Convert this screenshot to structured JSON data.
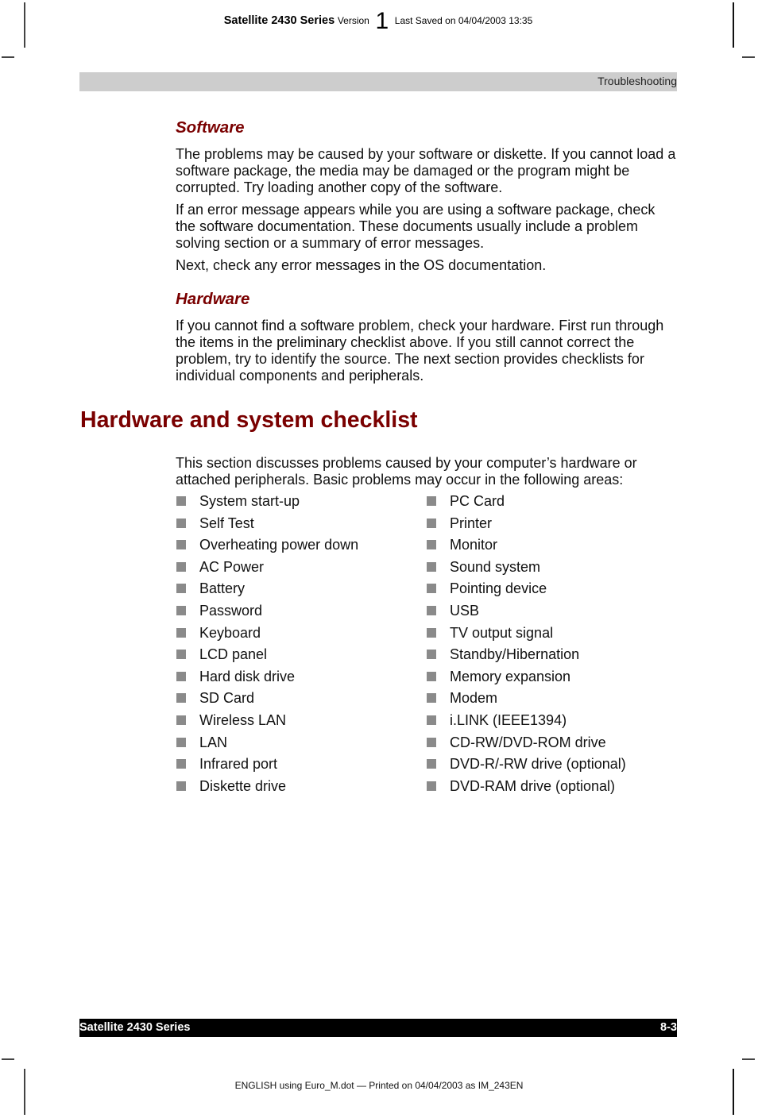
{
  "top_info": {
    "title": "Satellite 2430 Series",
    "version_label": "Version",
    "version_number": "1",
    "last_saved": "Last Saved on 04/04/2003 13:35"
  },
  "header": {
    "section": "Troubleshooting"
  },
  "software": {
    "heading": "Software",
    "paragraphs": [
      "The problems may be caused by your software or diskette. If you cannot load a software package, the media may be damaged or the program might be corrupted. Try loading another copy of the software.",
      "If an error message appears while you are using a software package, check the software documentation. These documents usually include a problem solving section or a summary of error messages.",
      "Next, check any error messages in the OS documentation."
    ]
  },
  "hardware": {
    "heading": "Hardware",
    "paragraphs": [
      "If you cannot find a software problem, check your hardware. First run through the items in the preliminary checklist above. If you still cannot correct the problem, try to identify the source. The next section provides checklists for individual components and peripherals."
    ]
  },
  "checklist": {
    "heading": "Hardware and system checklist",
    "intro": "This section discusses problems caused by your computer’s hardware or attached peripherals. Basic problems may occur in the following areas:",
    "left_items": [
      "System start-up",
      "Self Test",
      "Overheating power down",
      "AC Power",
      "Battery",
      "Password",
      "Keyboard",
      "LCD panel",
      "Hard disk drive",
      "SD Card",
      "Wireless LAN",
      "LAN",
      "Infrared port",
      "Diskette drive"
    ],
    "right_items": [
      "PC Card",
      "Printer",
      "Monitor",
      "Sound system",
      "Pointing device",
      "USB",
      "TV output signal",
      "Standby/Hibernation",
      "Memory expansion",
      "Modem",
      "i.LINK (IEEE1394)",
      "CD-RW/DVD-ROM drive",
      "DVD-R/-RW drive (optional)",
      "DVD-RAM drive (optional)"
    ]
  },
  "footer": {
    "product": "Satellite 2430 Series",
    "page_number": "8-3",
    "print_info": "ENGLISH using Euro_M.dot — Printed on 04/04/2003 as IM_243EN"
  }
}
